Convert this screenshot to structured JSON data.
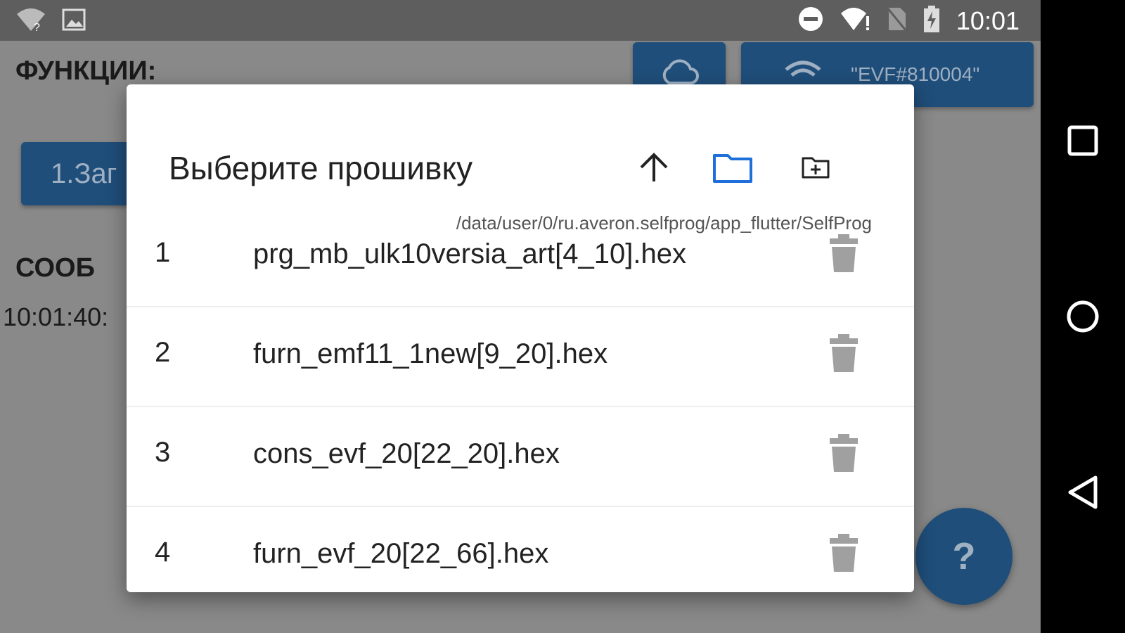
{
  "status_bar": {
    "time": "10:01"
  },
  "background_app": {
    "functions_title": "ФУНКЦИИ:",
    "device_button_label": "\"EVF#810004\"",
    "step_button_label": "1.Заг",
    "messages_title": "СООБ",
    "log_line": "10:01:40:",
    "help_fab_label": "?"
  },
  "dialog": {
    "title": "Выберите прошивку",
    "path": "/data/user/0/ru.averon.selfprog/app_flutter/SelfProg",
    "files": [
      {
        "index": "1",
        "name": "prg_mb_ulk10versia_art[4_10].hex"
      },
      {
        "index": "2",
        "name": "furn_emf11_1new[9_20].hex"
      },
      {
        "index": "3",
        "name": "cons_evf_20[22_20].hex"
      },
      {
        "index": "4",
        "name": "furn_evf_20[22_66].hex"
      }
    ]
  },
  "colors": {
    "accent": "#1e6fd9",
    "app_button": "#1f4e7a",
    "scrim": "#898989",
    "trash": "#a0a0a0"
  }
}
